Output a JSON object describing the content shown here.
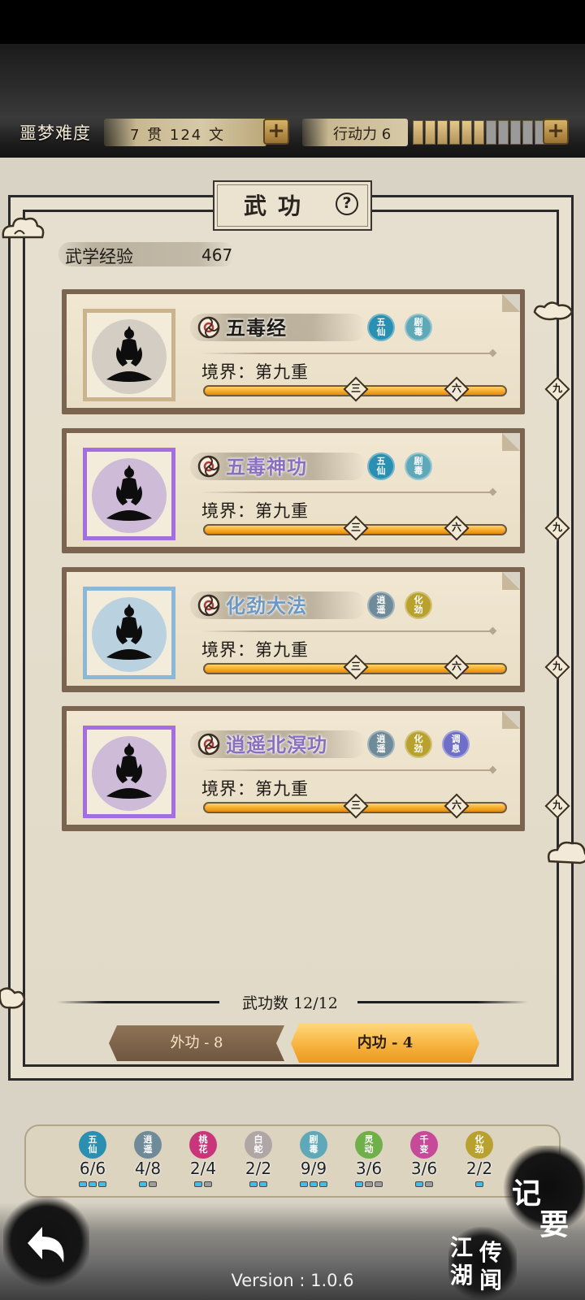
{
  "header": {
    "difficulty_label": "噩梦难度",
    "money_text": "7 贯 124 文",
    "stamina_text": "行动力 6",
    "stamina_filled": 6,
    "stamina_total": 11
  },
  "panel": {
    "title": "武功",
    "exp_label": "武学经验",
    "exp_value": "467"
  },
  "skills": [
    {
      "name": "五毒经",
      "name_color": "#1e1a15",
      "portrait_color": "#cfcac1",
      "frame_color": "#c9b48e",
      "realm": "境界：第九重",
      "progress": 1.0,
      "badges": [
        {
          "text": "五\n仙",
          "color": "#2a8fb0"
        },
        {
          "text": "剧\n毒",
          "color": "#5fa8b8"
        }
      ]
    },
    {
      "name": "五毒神功",
      "name_color": "#8a6fc0",
      "portrait_color": "#c9b6d6",
      "frame_color": "#a36ee0",
      "realm": "境界：第九重",
      "progress": 1.0,
      "badges": [
        {
          "text": "五\n仙",
          "color": "#2a8fb0"
        },
        {
          "text": "剧\n毒",
          "color": "#5fa8b8"
        }
      ]
    },
    {
      "name": "化劲大法",
      "name_color": "#6c98c4",
      "portrait_color": "#b4cfdf",
      "frame_color": "#8bb8d6",
      "realm": "境界：第九重",
      "progress": 1.0,
      "badges": [
        {
          "text": "逍\n遥",
          "color": "#6f8a98"
        },
        {
          "text": "化\n劲",
          "color": "#b8a12e"
        }
      ]
    },
    {
      "name": "逍遥北溟功",
      "name_color": "#8a6fc0",
      "portrait_color": "#c9b6d6",
      "frame_color": "#a36ee0",
      "realm": "境界：第九重",
      "progress": 1.0,
      "badges": [
        {
          "text": "逍\n遥",
          "color": "#6f8a98"
        },
        {
          "text": "化\n劲",
          "color": "#b8a12e"
        },
        {
          "text": "调\n息",
          "color": "#6f6fc8"
        }
      ]
    }
  ],
  "progress_ticks": [
    "三",
    "六",
    "九"
  ],
  "footer_panel": {
    "count_text": "武功数 12/12",
    "tab_outer": "外功 - 8",
    "tab_inner": "内功 - 4"
  },
  "schools": [
    {
      "badge": "五\n仙",
      "color": "#2a8fb0",
      "count": "6/6",
      "on": 3,
      "total": 3
    },
    {
      "badge": "逍\n遥",
      "color": "#6f8a98",
      "count": "4/8",
      "on": 1,
      "total": 2
    },
    {
      "badge": "桃\n花",
      "color": "#c8357a",
      "count": "2/4",
      "on": 1,
      "total": 2
    },
    {
      "badge": "白\n蛇",
      "color": "#b0a6a6",
      "count": "2/2",
      "on": 2,
      "total": 2
    },
    {
      "badge": "剧\n毒",
      "color": "#5fa8b8",
      "count": "9/9",
      "on": 3,
      "total": 3
    },
    {
      "badge": "灵\n动",
      "color": "#6fb04a",
      "count": "3/6",
      "on": 1,
      "total": 3
    },
    {
      "badge": "千\n变",
      "color": "#c8489a",
      "count": "3/6",
      "on": 1,
      "total": 2
    },
    {
      "badge": "化\n劲",
      "color": "#b8a12e",
      "count": "2/2",
      "on": 1,
      "total": 1
    }
  ],
  "bottom": {
    "version": "Version : 1.0.6",
    "notes_1": "记",
    "notes_2": "要",
    "rumor_1": "江",
    "rumor_2": "湖",
    "rumor_3": "传",
    "rumor_4": "闻"
  }
}
